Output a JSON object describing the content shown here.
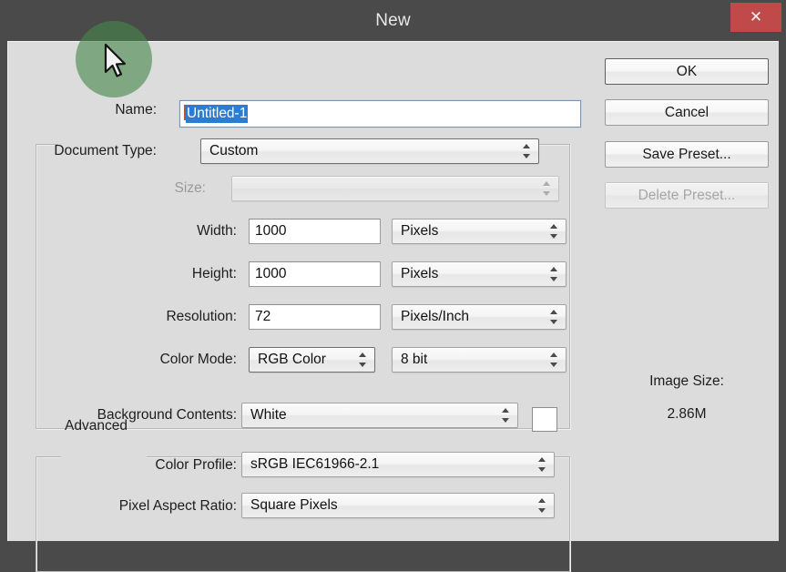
{
  "window": {
    "title": "New",
    "close_label": "✕"
  },
  "name_row": {
    "label": "Name:",
    "value": "Untitled-1",
    "selected": true
  },
  "preset_group": {
    "document_type": {
      "label": "Document Type:",
      "value": "Custom",
      "enabled": true
    },
    "size": {
      "label": "Size:",
      "value": "",
      "enabled": false
    },
    "width": {
      "label": "Width:",
      "value": "1000",
      "unit": "Pixels"
    },
    "height": {
      "label": "Height:",
      "value": "1000",
      "unit": "Pixels"
    },
    "resolution": {
      "label": "Resolution:",
      "value": "72",
      "unit": "Pixels/Inch"
    },
    "color_mode": {
      "label": "Color Mode:",
      "value": "RGB Color",
      "depth": "8 bit"
    },
    "background_contents": {
      "label": "Background Contents:",
      "value": "White",
      "swatch_color": "#ffffff"
    }
  },
  "advanced_group": {
    "legend": "Advanced",
    "color_profile": {
      "label": "Color Profile:",
      "value": "sRGB IEC61966-2.1"
    },
    "pixel_aspect_ratio": {
      "label": "Pixel Aspect Ratio:",
      "value": "Square Pixels"
    }
  },
  "buttons": {
    "ok": "OK",
    "cancel": "Cancel",
    "save_preset": "Save Preset...",
    "delete_preset": "Delete Preset..."
  },
  "image_size": {
    "label": "Image Size:",
    "value": "2.86M"
  },
  "colors": {
    "titlebar": "#4a4a4a",
    "dialog_bg": "#dcdcdc",
    "close_button": "#c04a4a",
    "selection": "#2b7cd3",
    "click_halo": "#46874a"
  }
}
